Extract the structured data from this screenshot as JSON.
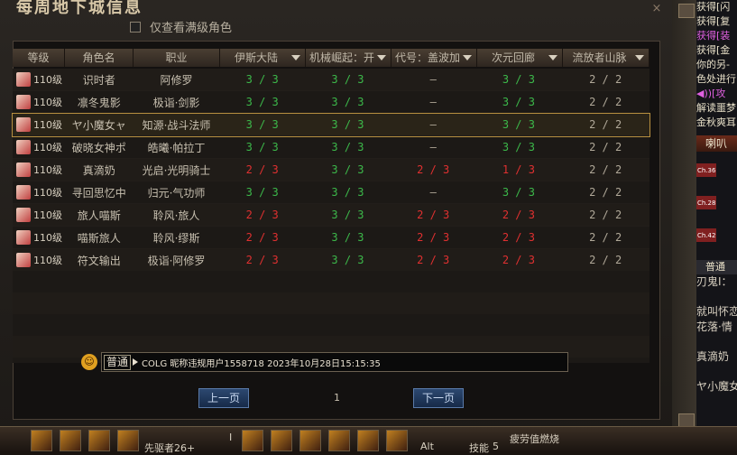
{
  "panel": {
    "title": "每周地下城信息",
    "filter_label": "仅查看满级角色",
    "close_label": "×"
  },
  "table": {
    "headers": [
      "等级",
      "角色名",
      "职业",
      "伊斯大陆",
      "机械崛起：开战",
      "代号：盖波加",
      "次元回廊",
      "流放者山脉"
    ],
    "rows": [
      {
        "level": "110级",
        "name": "识时者",
        "job": "阿修罗",
        "d1": "3 / 3",
        "d2": "3 / 3",
        "d3": "–",
        "d4": "3 / 3",
        "d5": "2 / 2",
        "c": [
          "green",
          "green",
          "gray",
          "green",
          "gray"
        ]
      },
      {
        "level": "110级",
        "name": "凛冬鬼影",
        "job": "极诣·剑影",
        "d1": "3 / 3",
        "d2": "3 / 3",
        "d3": "–",
        "d4": "3 / 3",
        "d5": "2 / 2",
        "c": [
          "green",
          "green",
          "gray",
          "green",
          "gray"
        ]
      },
      {
        "level": "110级",
        "name": "ヤ小魔女ャ",
        "job": "知源·战斗法师",
        "d1": "3 / 3",
        "d2": "3 / 3",
        "d3": "–",
        "d4": "3 / 3",
        "d5": "2 / 2",
        "c": [
          "green",
          "green",
          "gray",
          "green",
          "gray"
        ],
        "selected": true
      },
      {
        "level": "110级",
        "name": "破晓女神ポ",
        "job": "皓曦·帕拉丁",
        "d1": "3 / 3",
        "d2": "3 / 3",
        "d3": "–",
        "d4": "3 / 3",
        "d5": "2 / 2",
        "c": [
          "green",
          "green",
          "gray",
          "green",
          "gray"
        ]
      },
      {
        "level": "110级",
        "name": "真滴奶",
        "job": "光启·光明骑士",
        "d1": "2 / 3",
        "d2": "3 / 3",
        "d3": "2 / 3",
        "d4": "1 / 3",
        "d5": "2 / 2",
        "c": [
          "red",
          "green",
          "red",
          "red",
          "gray"
        ]
      },
      {
        "level": "110级",
        "name": "寻回思忆中",
        "job": "归元·气功师",
        "d1": "3 / 3",
        "d2": "3 / 3",
        "d3": "–",
        "d4": "3 / 3",
        "d5": "2 / 2",
        "c": [
          "green",
          "green",
          "gray",
          "green",
          "gray"
        ]
      },
      {
        "level": "110级",
        "name": "旅人喵斯",
        "job": "聆风·旅人",
        "d1": "2 / 3",
        "d2": "3 / 3",
        "d3": "2 / 3",
        "d4": "2 / 3",
        "d5": "2 / 2",
        "c": [
          "red",
          "green",
          "red",
          "red",
          "gray"
        ]
      },
      {
        "level": "110级",
        "name": "喵斯旅人",
        "job": "聆风·缪斯",
        "d1": "2 / 3",
        "d2": "3 / 3",
        "d3": "2 / 3",
        "d4": "2 / 3",
        "d5": "2 / 2",
        "c": [
          "red",
          "green",
          "red",
          "red",
          "gray"
        ]
      },
      {
        "level": "110级",
        "name": "符文输出",
        "job": "极诣·阿修罗",
        "d1": "2 / 3",
        "d2": "3 / 3",
        "d3": "2 / 3",
        "d4": "2 / 3",
        "d5": "2 / 2",
        "c": [
          "red",
          "green",
          "red",
          "red",
          "gray"
        ]
      }
    ]
  },
  "chat": {
    "mode": "普通",
    "text": "COLG 昵称违规用户1558718 2023年10月28日15:15:35"
  },
  "pagination": {
    "prev": "上一页",
    "page": "1",
    "next": "下一页"
  },
  "sidebar": {
    "lines": [
      "获得[闪",
      "获得[复",
      "获得[装",
      "获得[金",
      "你的另-",
      "色处进行",
      "◀))[攻",
      "解读噩梦",
      "金秋爽耳"
    ],
    "header": "喇叭",
    "channels": [
      "Ch.36",
      "Ch.28",
      "Ch.42"
    ],
    "channel_mode": "普通",
    "chat": [
      "刃鬼I：",
      "就叫怀恋",
      "花落·情",
      "真滴奶",
      "ヤ小魔女"
    ]
  },
  "bottom": {
    "char_name": "先驱者26+",
    "status": "疲劳值燃烧",
    "skill_label": "技能",
    "skill_num": "5",
    "alt": "Alt",
    "key_i": "I"
  },
  "colors": {
    "green": "#3cb84a",
    "red": "#e03030",
    "selected_outline": "#b89040"
  }
}
